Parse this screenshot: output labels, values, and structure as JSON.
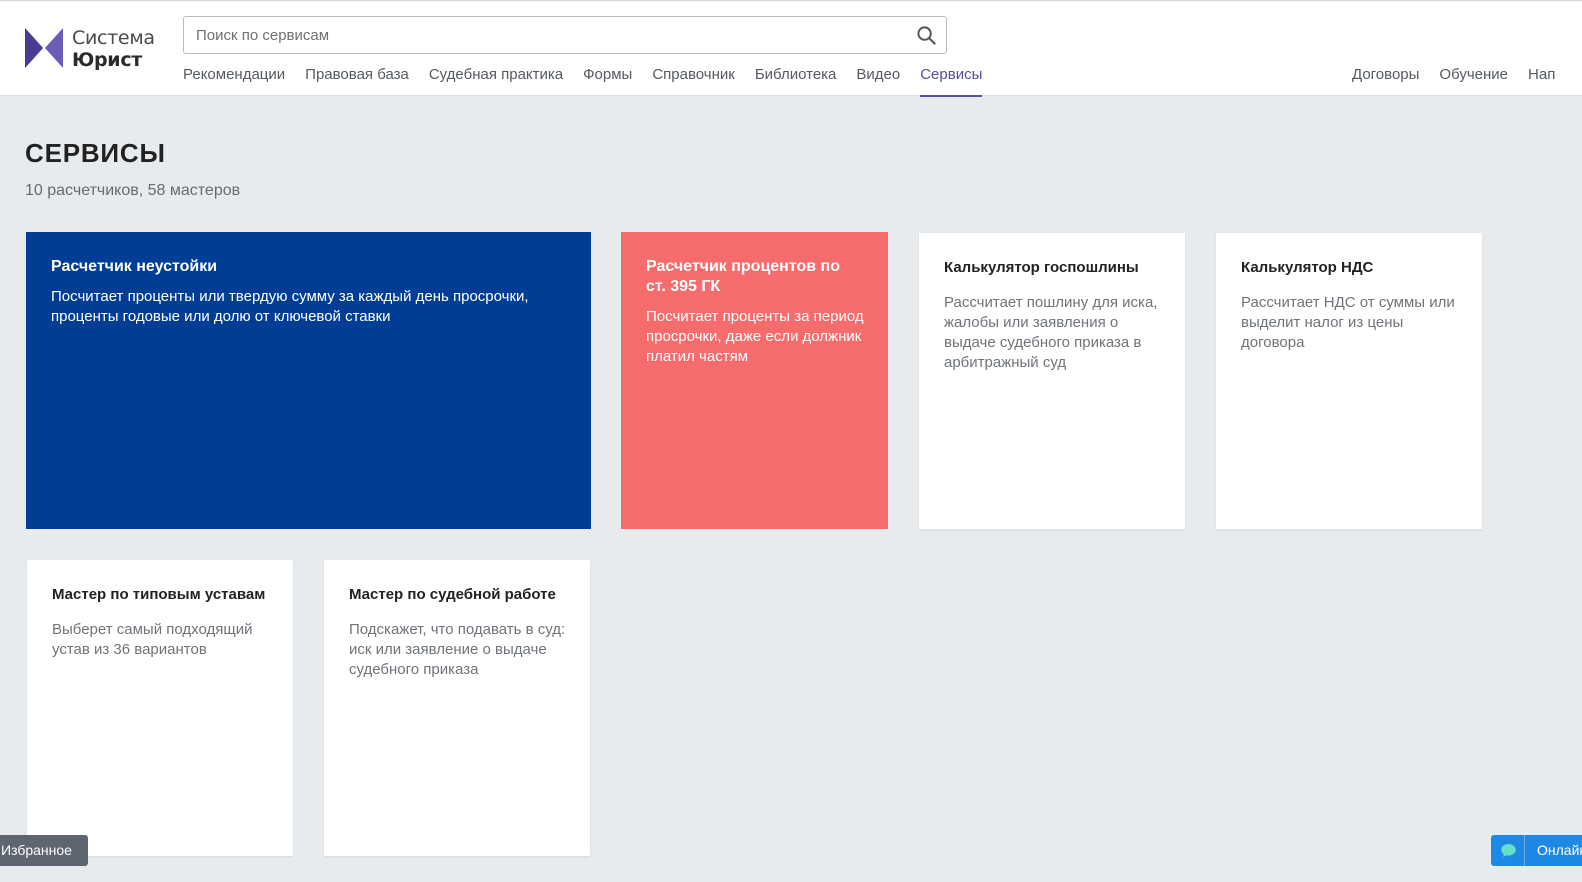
{
  "header": {
    "logo": {
      "line1": "Система",
      "line2": "Юрист",
      "colors": {
        "left": "#5b4aa6",
        "right": "#6d5bb8"
      }
    },
    "search": {
      "placeholder": "Поиск по сервисам",
      "value": ""
    },
    "nav": [
      {
        "label": "Рекомендации",
        "active": false
      },
      {
        "label": "Правовая база",
        "active": false
      },
      {
        "label": "Судебная практика",
        "active": false
      },
      {
        "label": "Формы",
        "active": false
      },
      {
        "label": "Справочник",
        "active": false
      },
      {
        "label": "Библиотека",
        "active": false
      },
      {
        "label": "Видео",
        "active": false
      },
      {
        "label": "Сервисы",
        "active": true
      }
    ],
    "nav_right": [
      {
        "label": "Договоры"
      },
      {
        "label": "Обучение"
      },
      {
        "label": "Нап"
      }
    ]
  },
  "page": {
    "title": "СЕРВИСЫ",
    "subtitle": "10 расчетчиков, 58 мастеров"
  },
  "cards": [
    {
      "title": "Расчетчик неустойки",
      "description": "Посчитает проценты или твердую сумму за каждый день просрочки, проценты годовые или долю от ключевой ставки",
      "color": "#003e96"
    },
    {
      "title": "Расчетчик процентов по ст. 395 ГК",
      "description": "Посчитает проценты за период просрочки, даже если должник платил частям",
      "color": "#f66b6b"
    },
    {
      "title": "Калькулятор госпошлины",
      "description": "Рассчитает пошлину для иска, жалобы или заявления о выдаче судебного приказа в арбитражный суд",
      "color": "#ffffff"
    },
    {
      "title": "Калькулятор НДС",
      "description": "Рассчитает НДС от суммы или выделит налог из цены договора",
      "color": "#ffffff"
    },
    {
      "title": "Мастер по типовым уставам",
      "description": "Выберет самый подходящий устав из 36 вариантов",
      "color": "#ffffff"
    },
    {
      "title": "Мастер по судебной работе",
      "description": "Подскажет, что подавать в суд: иск или заявление о выдаче судебного приказа",
      "color": "#ffffff"
    }
  ],
  "floating": {
    "favorites_label": "Избранное",
    "online_label": "Онлайн",
    "online_icon": "chat-icon",
    "favorites_color": "#5d6571",
    "online_color": "#1e88e5"
  }
}
